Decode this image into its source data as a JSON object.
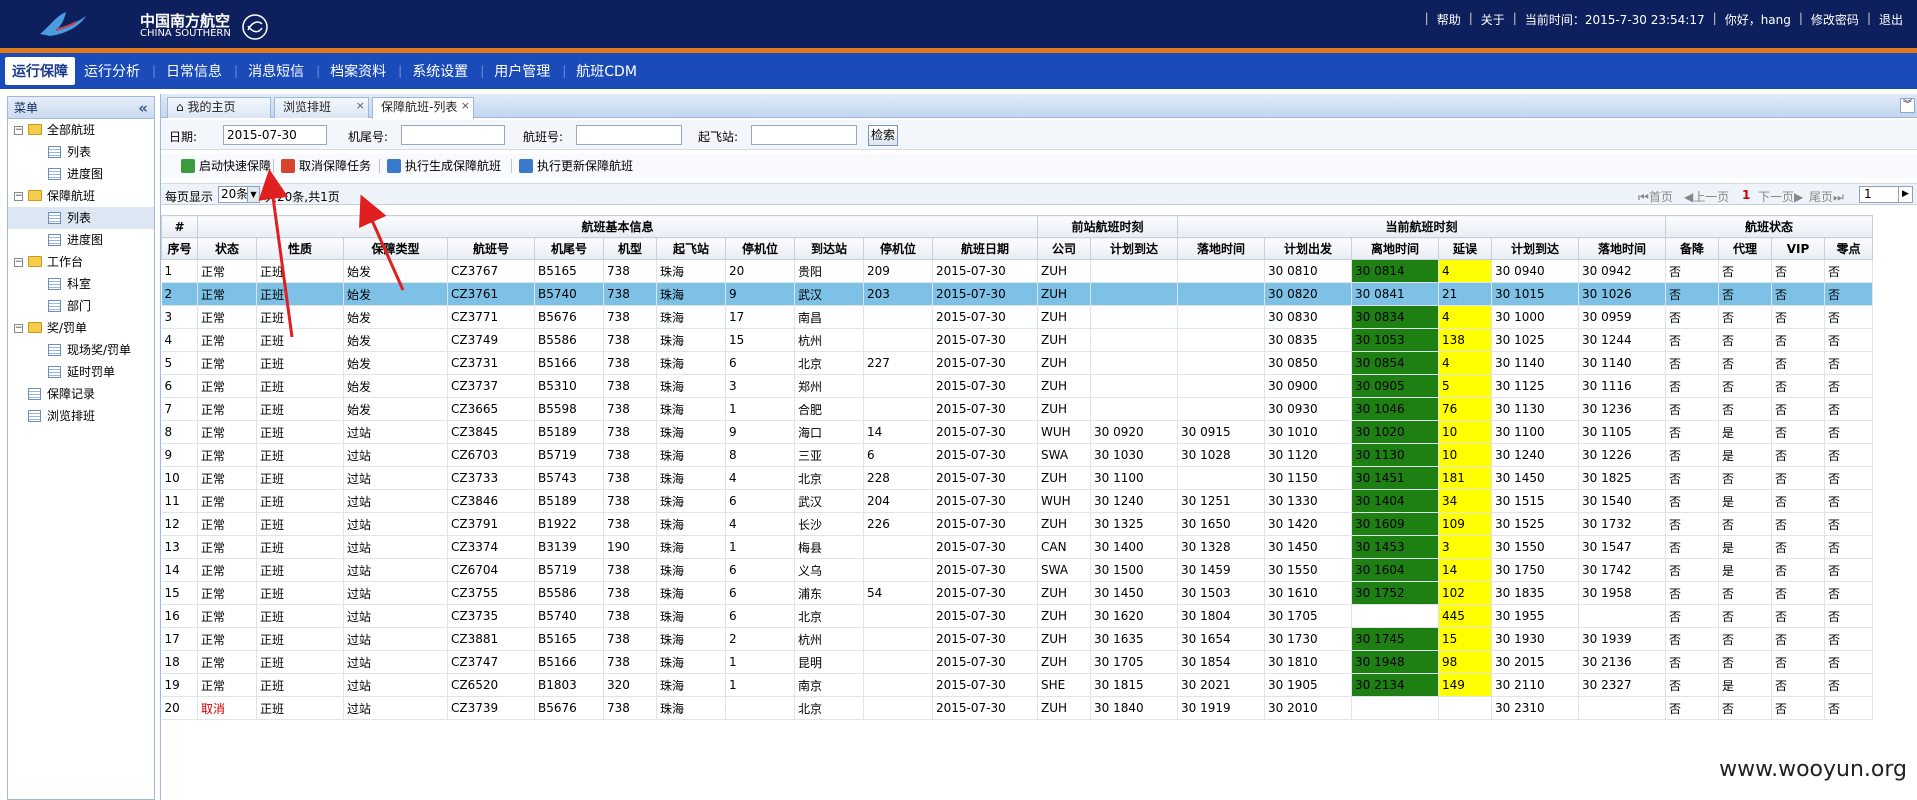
{
  "header": {
    "logo_cn": "中国南方航空",
    "logo_en": "CHINA SOUTHERN",
    "links": [
      "帮助",
      "关于",
      "当前时间：2015-7-30 23:54:17",
      "你好，hang",
      "修改密码",
      "退出"
    ]
  },
  "mainnav": [
    "运行保障",
    "运行分析",
    "日常信息",
    "消息短信",
    "档案资料",
    "系统设置",
    "用户管理",
    "航班CDM"
  ],
  "sidebar": {
    "title": "菜单",
    "collapse_icon": "«",
    "items": [
      {
        "label": "全部航班",
        "level": 0,
        "type": "folder",
        "toggle": "−"
      },
      {
        "label": "列表",
        "level": 1,
        "type": "page"
      },
      {
        "label": "进度图",
        "level": 1,
        "type": "page"
      },
      {
        "label": "保障航班",
        "level": 0,
        "type": "folder",
        "toggle": "−"
      },
      {
        "label": "列表",
        "level": 1,
        "type": "page",
        "selected": true
      },
      {
        "label": "进度图",
        "level": 1,
        "type": "page"
      },
      {
        "label": "工作台",
        "level": 0,
        "type": "folder",
        "toggle": "−"
      },
      {
        "label": "科室",
        "level": 1,
        "type": "page"
      },
      {
        "label": "部门",
        "level": 1,
        "type": "page"
      },
      {
        "label": "奖/罚单",
        "level": 0,
        "type": "folder",
        "toggle": "−"
      },
      {
        "label": "现场奖/罚单",
        "level": 1,
        "type": "page"
      },
      {
        "label": "延时罚单",
        "level": 1,
        "type": "page"
      },
      {
        "label": "保障记录",
        "level": 0,
        "type": "page"
      },
      {
        "label": "浏览排班",
        "level": 0,
        "type": "page"
      }
    ]
  },
  "tabs": [
    {
      "label": "我的主页",
      "icon": "⌂",
      "closable": false
    },
    {
      "label": "浏览排班",
      "closable": true
    },
    {
      "label": "保障航班-列表",
      "closable": true,
      "active": true
    }
  ],
  "filter": {
    "date_label": "日期:",
    "date_value": "2015-07-30",
    "tail_label": "机尾号:",
    "flight_label": "航班号:",
    "dep_label": "起飞站:",
    "search_label": "检索"
  },
  "toolbar": {
    "start_label": "启动快速保障",
    "cancel_label": "取消保障任务",
    "gen_label": "执行生成保障航班",
    "update_label": "执行更新保障航班"
  },
  "pager": {
    "per_page_label": "每页显示",
    "page_size": "20条",
    "total": "共20条,共1页",
    "first": "首页",
    "prev": "上一页",
    "current": "1",
    "next": "下一页",
    "last": "尾页",
    "page_input": "1"
  },
  "grid": {
    "group_headers": [
      "#",
      "航班基本信息",
      "前站航班时刻",
      "当前航班时刻",
      "航班状态"
    ],
    "columns": [
      "序号",
      "状态",
      "性质",
      "保障类型",
      "航班号",
      "机尾号",
      "机型",
      "起飞站",
      "停机位",
      "到达站",
      "停机位",
      "航班日期",
      "公司",
      "计划到达",
      "落地时间",
      "计划出发",
      "离地时间",
      "延误",
      "计划到达",
      "落地时间",
      "备降",
      "代理",
      "VIP",
      "零点"
    ],
    "rows": [
      [
        "1",
        "正常",
        "正班",
        "始发",
        "CZ3767",
        "B5165",
        "738",
        "珠海",
        "20",
        "贵阳",
        "209",
        "2015-07-30",
        "ZUH",
        "",
        "",
        "30 0810",
        "30 0814",
        "4",
        "30 0940",
        "30 0942",
        "否",
        "否",
        "否",
        "否"
      ],
      [
        "2",
        "正常",
        "正班",
        "始发",
        "CZ3761",
        "B5740",
        "738",
        "珠海",
        "9",
        "武汉",
        "203",
        "2015-07-30",
        "ZUH",
        "",
        "",
        "30 0820",
        "30 0841",
        "21",
        "30 1015",
        "30 1026",
        "否",
        "否",
        "否",
        "否"
      ],
      [
        "3",
        "正常",
        "正班",
        "始发",
        "CZ3771",
        "B5676",
        "738",
        "珠海",
        "17",
        "南昌",
        "",
        "2015-07-30",
        "ZUH",
        "",
        "",
        "30 0830",
        "30 0834",
        "4",
        "30 1000",
        "30 0959",
        "否",
        "否",
        "否",
        "否"
      ],
      [
        "4",
        "正常",
        "正班",
        "始发",
        "CZ3749",
        "B5586",
        "738",
        "珠海",
        "15",
        "杭州",
        "",
        "2015-07-30",
        "ZUH",
        "",
        "",
        "30 0835",
        "30 1053",
        "138",
        "30 1025",
        "30 1244",
        "否",
        "否",
        "否",
        "否"
      ],
      [
        "5",
        "正常",
        "正班",
        "始发",
        "CZ3731",
        "B5166",
        "738",
        "珠海",
        "6",
        "北京",
        "227",
        "2015-07-30",
        "ZUH",
        "",
        "",
        "30 0850",
        "30 0854",
        "4",
        "30 1140",
        "30 1140",
        "否",
        "否",
        "否",
        "否"
      ],
      [
        "6",
        "正常",
        "正班",
        "始发",
        "CZ3737",
        "B5310",
        "738",
        "珠海",
        "3",
        "郑州",
        "",
        "2015-07-30",
        "ZUH",
        "",
        "",
        "30 0900",
        "30 0905",
        "5",
        "30 1125",
        "30 1116",
        "否",
        "否",
        "否",
        "否"
      ],
      [
        "7",
        "正常",
        "正班",
        "始发",
        "CZ3665",
        "B5598",
        "738",
        "珠海",
        "1",
        "合肥",
        "",
        "2015-07-30",
        "ZUH",
        "",
        "",
        "30 0930",
        "30 1046",
        "76",
        "30 1130",
        "30 1236",
        "否",
        "否",
        "否",
        "否"
      ],
      [
        "8",
        "正常",
        "正班",
        "过站",
        "CZ3845",
        "B5189",
        "738",
        "珠海",
        "9",
        "海口",
        "14",
        "2015-07-30",
        "WUH",
        "30 0920",
        "30 0915",
        "30 1010",
        "30 1020",
        "10",
        "30 1100",
        "30 1105",
        "否",
        "是",
        "否",
        "否"
      ],
      [
        "9",
        "正常",
        "正班",
        "过站",
        "CZ6703",
        "B5719",
        "738",
        "珠海",
        "8",
        "三亚",
        "6",
        "2015-07-30",
        "SWA",
        "30 1030",
        "30 1028",
        "30 1120",
        "30 1130",
        "10",
        "30 1240",
        "30 1226",
        "否",
        "是",
        "否",
        "否"
      ],
      [
        "10",
        "正常",
        "正班",
        "过站",
        "CZ3733",
        "B5743",
        "738",
        "珠海",
        "4",
        "北京",
        "228",
        "2015-07-30",
        "ZUH",
        "30 1100",
        "",
        "30 1150",
        "30 1451",
        "181",
        "30 1450",
        "30 1825",
        "否",
        "否",
        "否",
        "否"
      ],
      [
        "11",
        "正常",
        "正班",
        "过站",
        "CZ3846",
        "B5189",
        "738",
        "珠海",
        "6",
        "武汉",
        "204",
        "2015-07-30",
        "WUH",
        "30 1240",
        "30 1251",
        "30 1330",
        "30 1404",
        "34",
        "30 1515",
        "30 1540",
        "否",
        "是",
        "否",
        "否"
      ],
      [
        "12",
        "正常",
        "正班",
        "过站",
        "CZ3791",
        "B1922",
        "738",
        "珠海",
        "4",
        "长沙",
        "226",
        "2015-07-30",
        "ZUH",
        "30 1325",
        "30 1650",
        "30 1420",
        "30 1609",
        "109",
        "30 1525",
        "30 1732",
        "否",
        "否",
        "否",
        "否"
      ],
      [
        "13",
        "正常",
        "正班",
        "过站",
        "CZ3374",
        "B3139",
        "190",
        "珠海",
        "1",
        "梅县",
        "",
        "2015-07-30",
        "CAN",
        "30 1400",
        "30 1328",
        "30 1450",
        "30 1453",
        "3",
        "30 1550",
        "30 1547",
        "否",
        "是",
        "否",
        "否"
      ],
      [
        "14",
        "正常",
        "正班",
        "过站",
        "CZ6704",
        "B5719",
        "738",
        "珠海",
        "6",
        "义乌",
        "",
        "2015-07-30",
        "SWA",
        "30 1500",
        "30 1459",
        "30 1550",
        "30 1604",
        "14",
        "30 1750",
        "30 1742",
        "否",
        "是",
        "否",
        "否"
      ],
      [
        "15",
        "正常",
        "正班",
        "过站",
        "CZ3755",
        "B5586",
        "738",
        "珠海",
        "6",
        "浦东",
        "54",
        "2015-07-30",
        "ZUH",
        "30 1450",
        "30 1503",
        "30 1610",
        "30 1752",
        "102",
        "30 1835",
        "30 1958",
        "否",
        "否",
        "否",
        "否"
      ],
      [
        "16",
        "正常",
        "正班",
        "过站",
        "CZ3735",
        "B5740",
        "738",
        "珠海",
        "6",
        "北京",
        "",
        "2015-07-30",
        "ZUH",
        "30 1620",
        "30 1804",
        "30 1705",
        "",
        "445",
        "30 1955",
        "",
        "否",
        "否",
        "否",
        "否"
      ],
      [
        "17",
        "正常",
        "正班",
        "过站",
        "CZ3881",
        "B5165",
        "738",
        "珠海",
        "2",
        "杭州",
        "",
        "2015-07-30",
        "ZUH",
        "30 1635",
        "30 1654",
        "30 1730",
        "30 1745",
        "15",
        "30 1930",
        "30 1939",
        "否",
        "否",
        "否",
        "否"
      ],
      [
        "18",
        "正常",
        "正班",
        "过站",
        "CZ3747",
        "B5166",
        "738",
        "珠海",
        "1",
        "昆明",
        "",
        "2015-07-30",
        "ZUH",
        "30 1705",
        "30 1854",
        "30 1810",
        "30 1948",
        "98",
        "30 2015",
        "30 2136",
        "否",
        "否",
        "否",
        "否"
      ],
      [
        "19",
        "正常",
        "正班",
        "过站",
        "CZ6520",
        "B1803",
        "320",
        "珠海",
        "1",
        "南京",
        "",
        "2015-07-30",
        "SHE",
        "30 1815",
        "30 2021",
        "30 1905",
        "30 2134",
        "149",
        "30 2110",
        "30 2327",
        "否",
        "是",
        "否",
        "否"
      ],
      [
        "20",
        "取消",
        "正班",
        "过站",
        "CZ3739",
        "B5676",
        "738",
        "珠海",
        "",
        "北京",
        "",
        "2015-07-30",
        "ZUH",
        "30 1840",
        "30 1919",
        "30 2010",
        "",
        "",
        "30 2310",
        "",
        "否",
        "否",
        "否",
        "否"
      ]
    ],
    "selected_row": 1
  },
  "watermark": "www.wooyun.org",
  "colors": {
    "header_bg": "#0d1f5c",
    "nav_bg": "#1a4bb8",
    "accent_orange": "#e07a1a",
    "selected_row": "#7ec1e6",
    "takeoff_green": "#1e8012",
    "delay_yellow": "#ffff00",
    "cancel_red": "#d40000",
    "annotation_red": "#e02020"
  }
}
